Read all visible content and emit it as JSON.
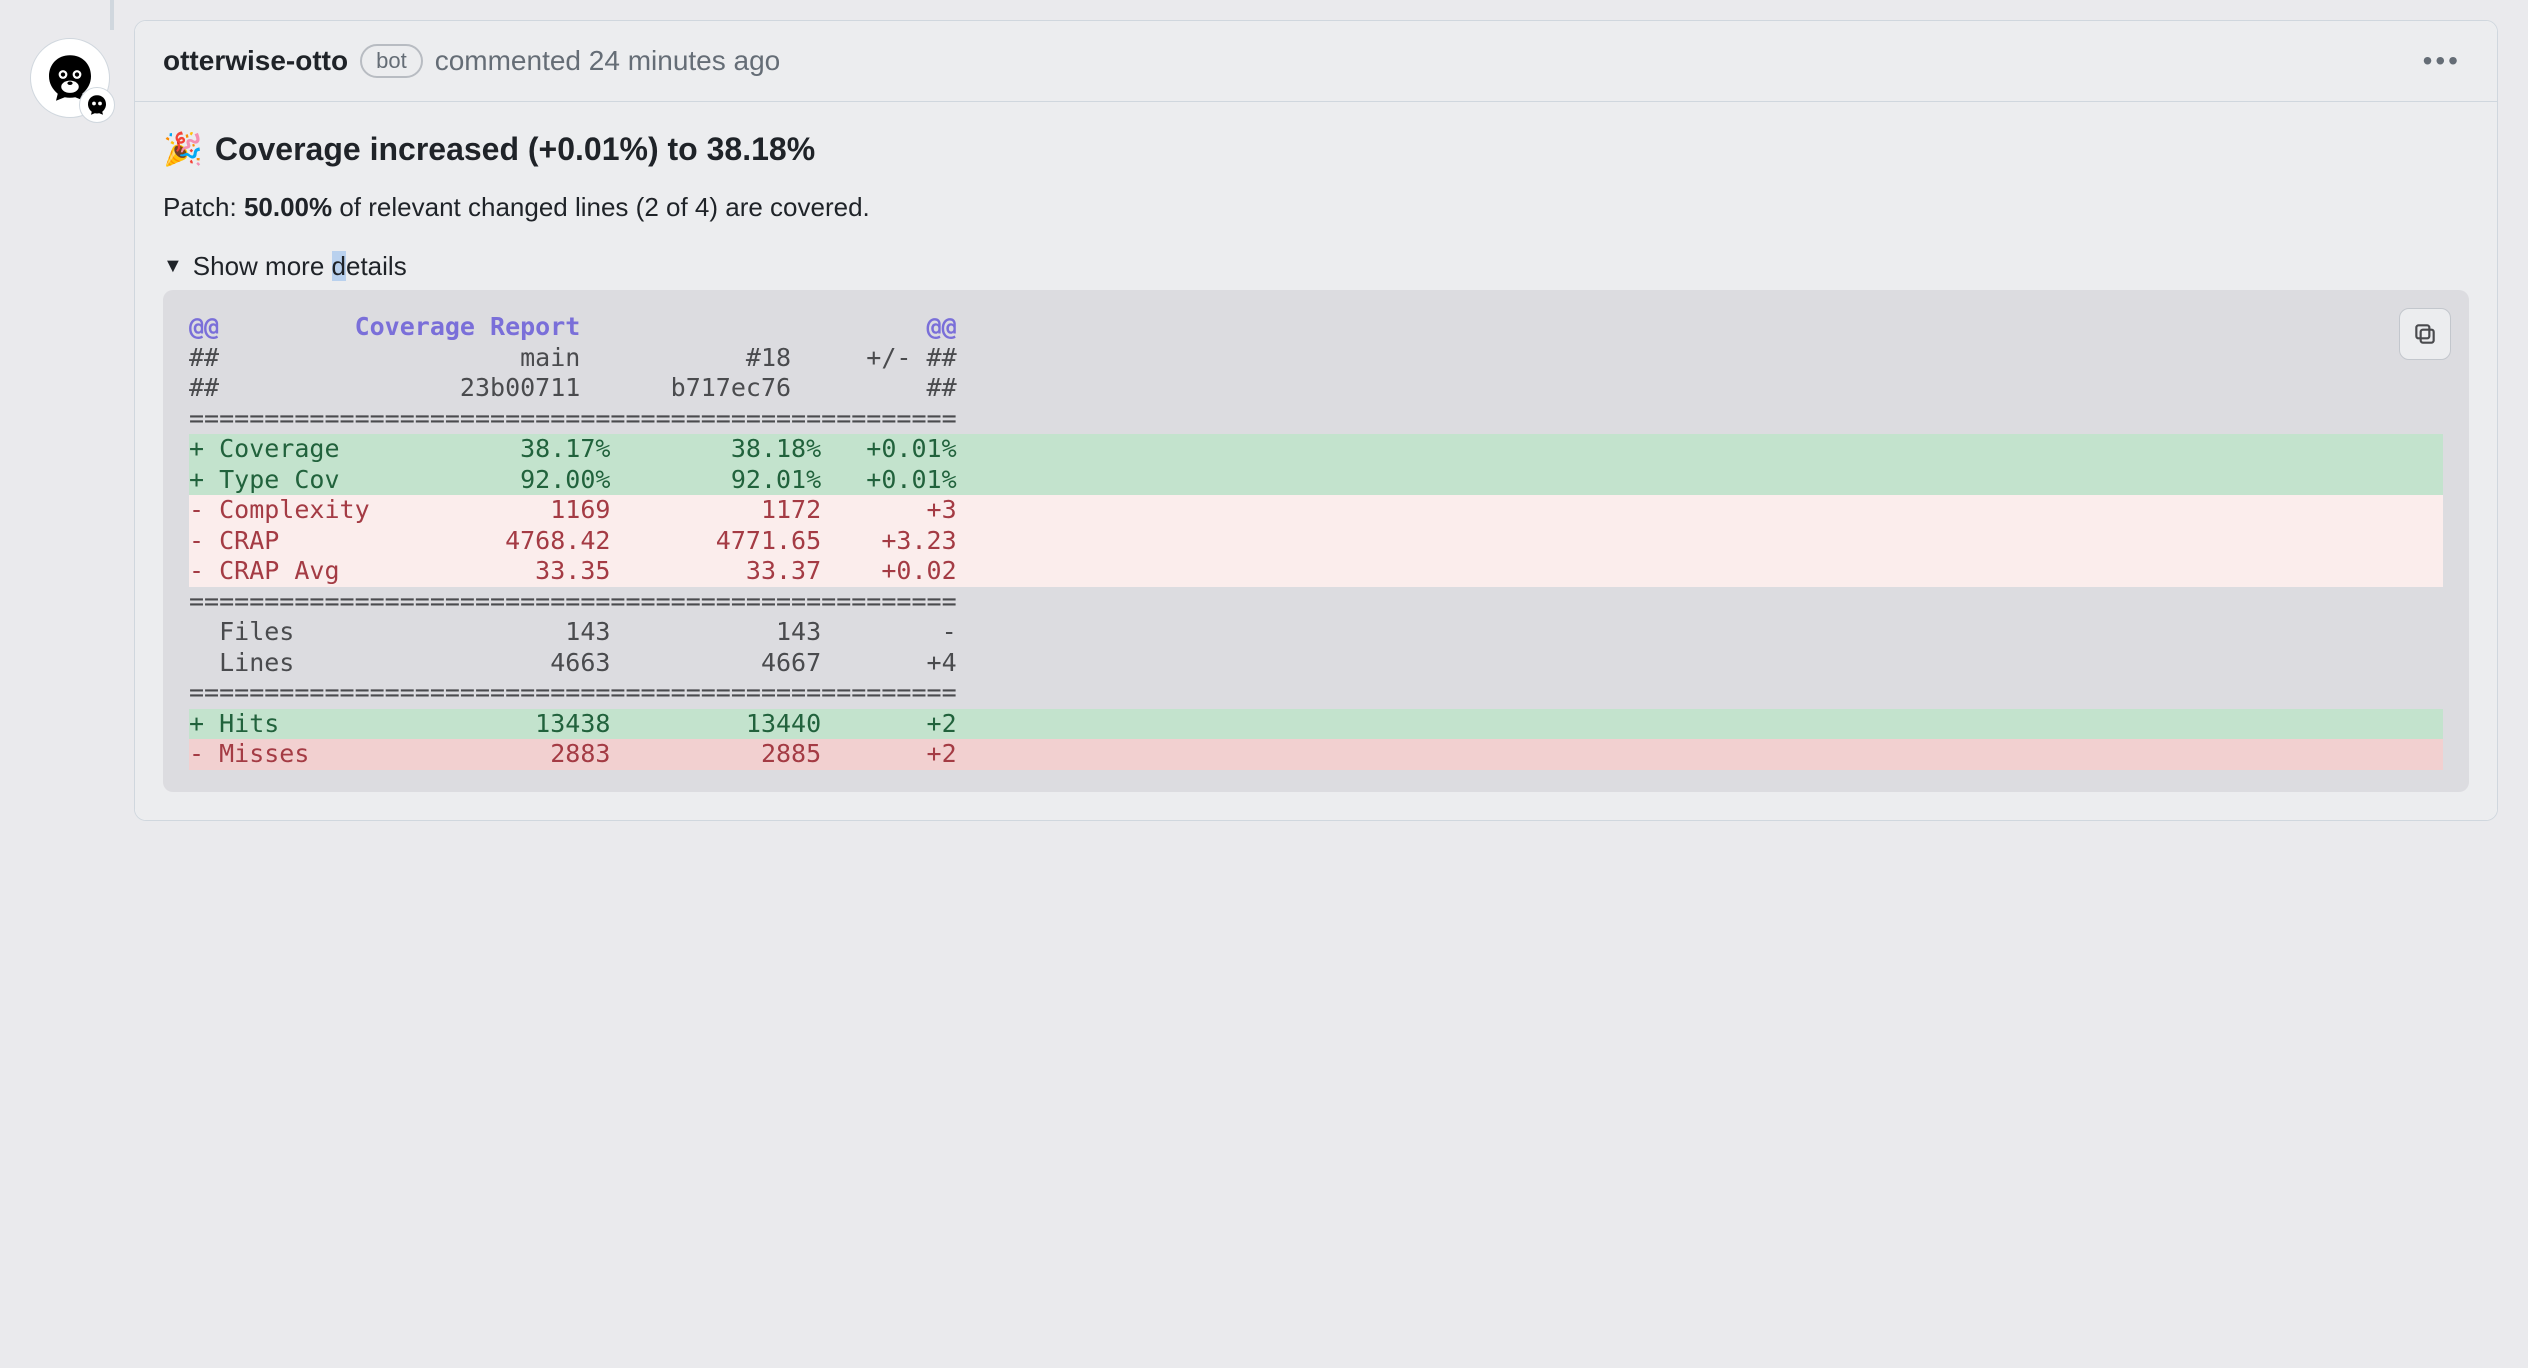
{
  "header": {
    "author": "otterwise-otto",
    "bot_badge": "bot",
    "action": "commented",
    "timestamp": "24 minutes ago"
  },
  "body": {
    "emoji": "🎉",
    "title": "Coverage increased (+0.01%) to 38.18%",
    "patch_prefix": "Patch: ",
    "patch_pct": "50.00%",
    "patch_suffix": " of relevant changed lines (2 of 4) are covered.",
    "details_label_prefix": "Show more ",
    "details_label_hl": "d",
    "details_label_rest": "etails"
  },
  "report": {
    "header_left": "@@",
    "header_title": "Coverage Report",
    "header_right": "@@",
    "col_meta1": {
      "left": "##",
      "main": "main",
      "build": "#18",
      "delta": "+/-",
      "right": "##"
    },
    "col_meta2": {
      "left": "##",
      "main": "23b00711",
      "build": "b717ec76",
      "delta": "",
      "right": "##"
    },
    "sep": "===================================================",
    "rows1": [
      {
        "type": "add",
        "label": "Coverage",
        "main": "38.17%",
        "build": "38.18%",
        "delta": "+0.01%"
      },
      {
        "type": "add",
        "label": "Type Cov",
        "main": "92.00%",
        "build": "92.01%",
        "delta": "+0.01%"
      },
      {
        "type": "delsoft",
        "label": "Complexity",
        "main": "1169",
        "build": "1172",
        "delta": "+3"
      },
      {
        "type": "delsoft",
        "label": "CRAP",
        "main": "4768.42",
        "build": "4771.65",
        "delta": "+3.23"
      },
      {
        "type": "delsoft",
        "label": "CRAP Avg",
        "main": "33.35",
        "build": "33.37",
        "delta": "+0.02"
      }
    ],
    "rows2": [
      {
        "type": "plain",
        "label": "Files",
        "main": "143",
        "build": "143",
        "delta": "-"
      },
      {
        "type": "plain",
        "label": "Lines",
        "main": "4663",
        "build": "4667",
        "delta": "+4"
      }
    ],
    "rows3": [
      {
        "type": "add",
        "label": "Hits",
        "main": "13438",
        "build": "13440",
        "delta": "+2"
      },
      {
        "type": "delstrong",
        "label": "Misses",
        "main": "2883",
        "build": "2885",
        "delta": "+2"
      }
    ]
  }
}
